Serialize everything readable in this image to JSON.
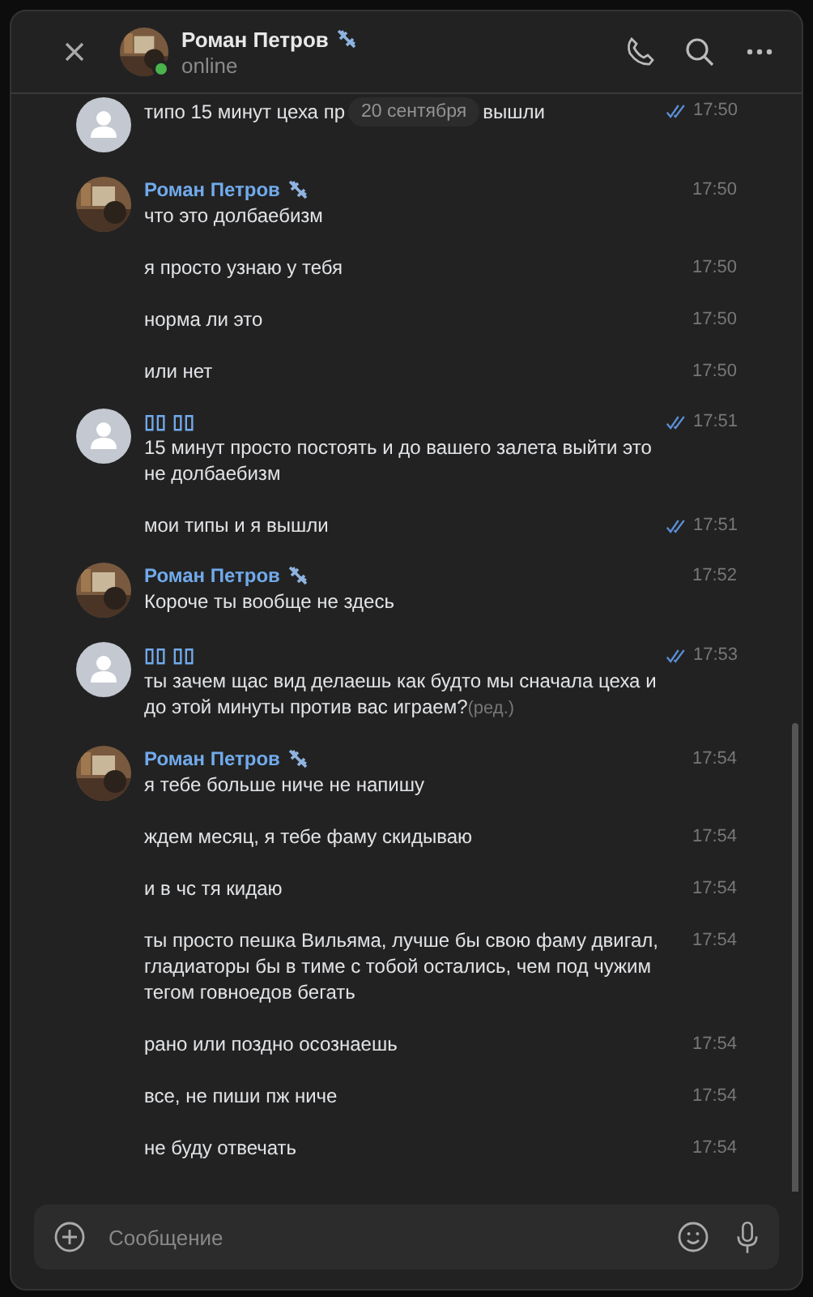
{
  "header": {
    "name": "Роман Петров",
    "status": "online",
    "online": true
  },
  "date_badge": "20 сентября",
  "groups": [
    {
      "kind": "contact",
      "messages": [
        {
          "parts": [
            "типо 15 минут цеха пр",
            "вышли"
          ],
          "time": "17:50",
          "read": true
        }
      ]
    },
    {
      "kind": "friend",
      "author": "Роман Петров",
      "messages": [
        {
          "parts": [
            "что это долбаебизм"
          ],
          "time": "17:50",
          "read": false
        },
        {
          "parts": [
            "я просто узнаю у тебя"
          ],
          "time": "17:50",
          "read": false
        },
        {
          "parts": [
            "норма ли это"
          ],
          "time": "17:50",
          "read": false
        },
        {
          "parts": [
            "или нет"
          ],
          "time": "17:50",
          "read": false
        }
      ]
    },
    {
      "kind": "contact",
      "author": "▯▯ ▯▯",
      "messages": [
        {
          "parts": [
            "15 минут просто постоять и до вашего залета выйти это не долбаебизм"
          ],
          "time": "17:51",
          "read": true
        },
        {
          "parts": [
            "мои типы и я вышли"
          ],
          "time": "17:51",
          "read": true
        }
      ]
    },
    {
      "kind": "friend",
      "author": "Роман Петров",
      "messages": [
        {
          "parts": [
            "Короче ты вообще не здесь"
          ],
          "time": "17:52",
          "read": false
        }
      ]
    },
    {
      "kind": "contact",
      "author": "▯▯ ▯▯",
      "messages": [
        {
          "parts": [
            "ты зачем щас вид делаешь как будто мы сначала цеха и до этой минуты против вас играем?"
          ],
          "time": "17:53",
          "read": true,
          "edited": "(ред.)"
        }
      ]
    },
    {
      "kind": "friend",
      "author": "Роман Петров",
      "messages": [
        {
          "parts": [
            "я тебе больше ниче не напишу"
          ],
          "time": "17:54",
          "read": false
        },
        {
          "parts": [
            "ждем месяц, я тебе фаму скидываю"
          ],
          "time": "17:54",
          "read": false
        },
        {
          "parts": [
            "и в чс тя кидаю"
          ],
          "time": "17:54",
          "read": false
        },
        {
          "parts": [
            "ты просто пешка Вильяма, лучше бы свою фаму двигал, гладиаторы бы в тиме с тобой остались, чем под чужим тегом говноедов бегать"
          ],
          "time": "17:54",
          "read": false
        },
        {
          "parts": [
            "рано или поздно осознаешь"
          ],
          "time": "17:54",
          "read": false
        },
        {
          "parts": [
            "все, не пиши пж ниче"
          ],
          "time": "17:54",
          "read": false
        },
        {
          "parts": [
            "не буду отвечать"
          ],
          "time": "17:54",
          "read": false
        }
      ]
    }
  ],
  "composer": {
    "placeholder": "Сообщение"
  }
}
